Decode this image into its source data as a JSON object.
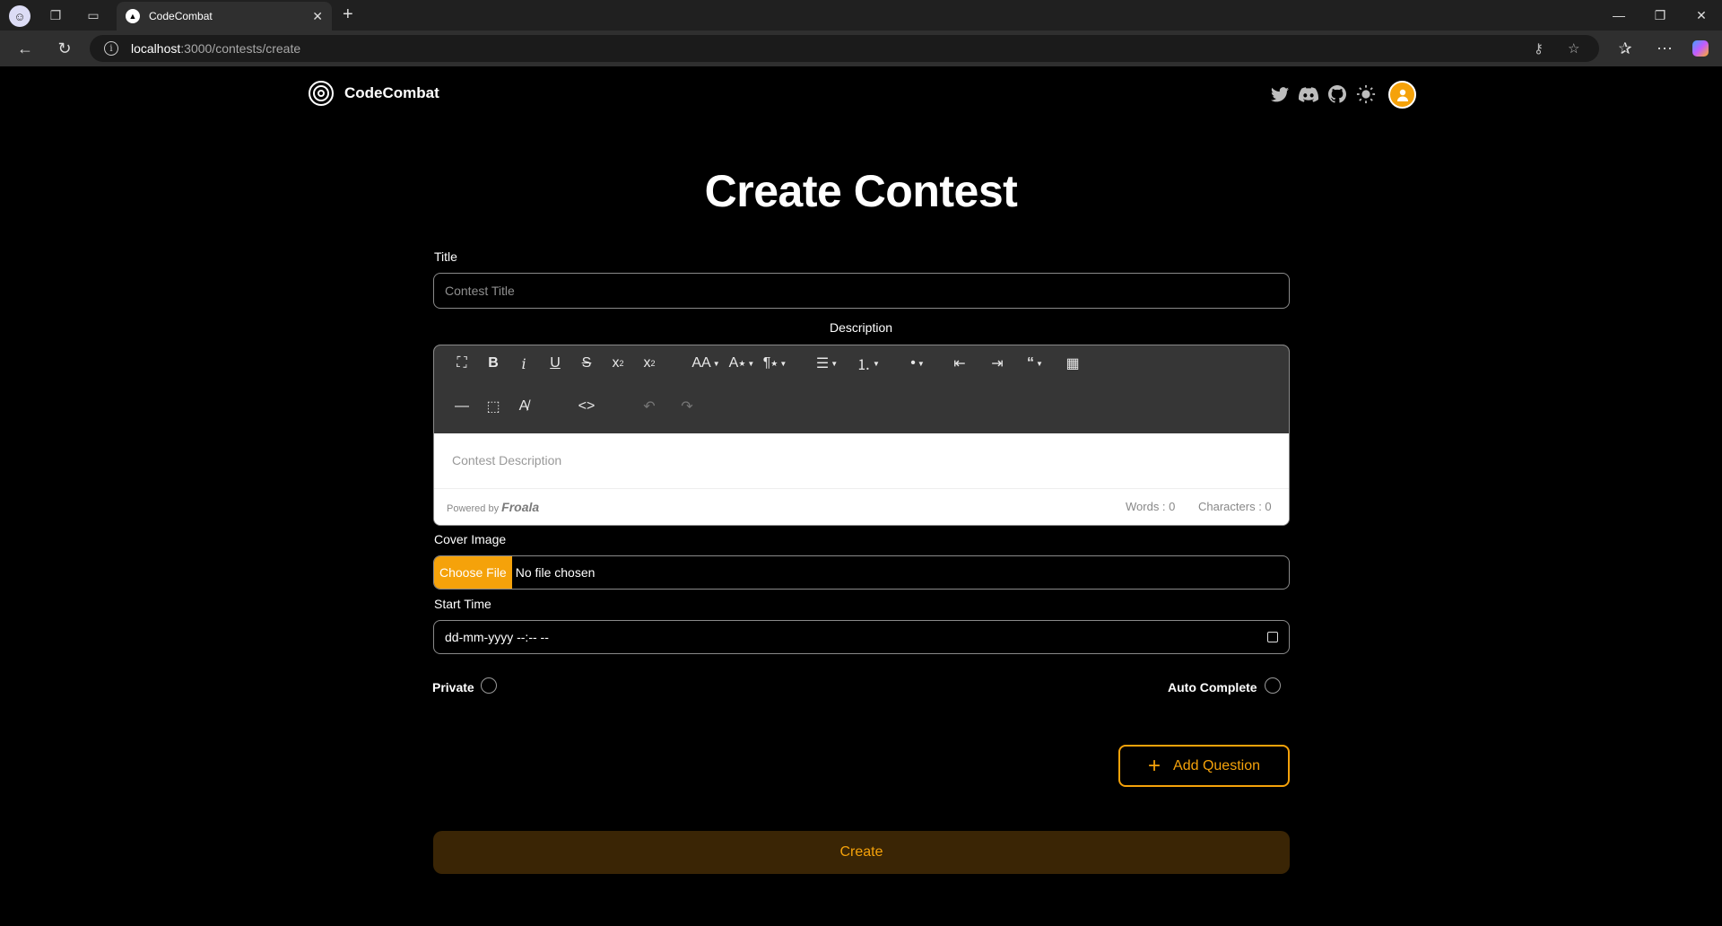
{
  "browser": {
    "tab_title": "CodeCombat",
    "url_host": "localhost",
    "url_path": ":3000/contests/create"
  },
  "header": {
    "brand": "CodeCombat",
    "social_icons": [
      "twitter-icon",
      "discord-icon",
      "github-icon",
      "theme-toggle-icon"
    ],
    "accent_color": "#f5a20a"
  },
  "form": {
    "page_title": "Create Contest",
    "title_label": "Title",
    "title_placeholder": "Contest Title",
    "description_label": "Description",
    "description_placeholder": "Contest Description",
    "powered_by": "Powered by",
    "froala": "Froala",
    "words": "Words : 0",
    "characters": "Characters : 0",
    "cover_label": "Cover Image",
    "choose_file": "Choose File",
    "no_file": "No file chosen",
    "start_label": "Start Time",
    "start_value": "dd-mm-yyyy --:-- --",
    "private_label": "Private",
    "auto_label": "Auto Complete",
    "add_question": "Add Question",
    "create": "Create"
  }
}
